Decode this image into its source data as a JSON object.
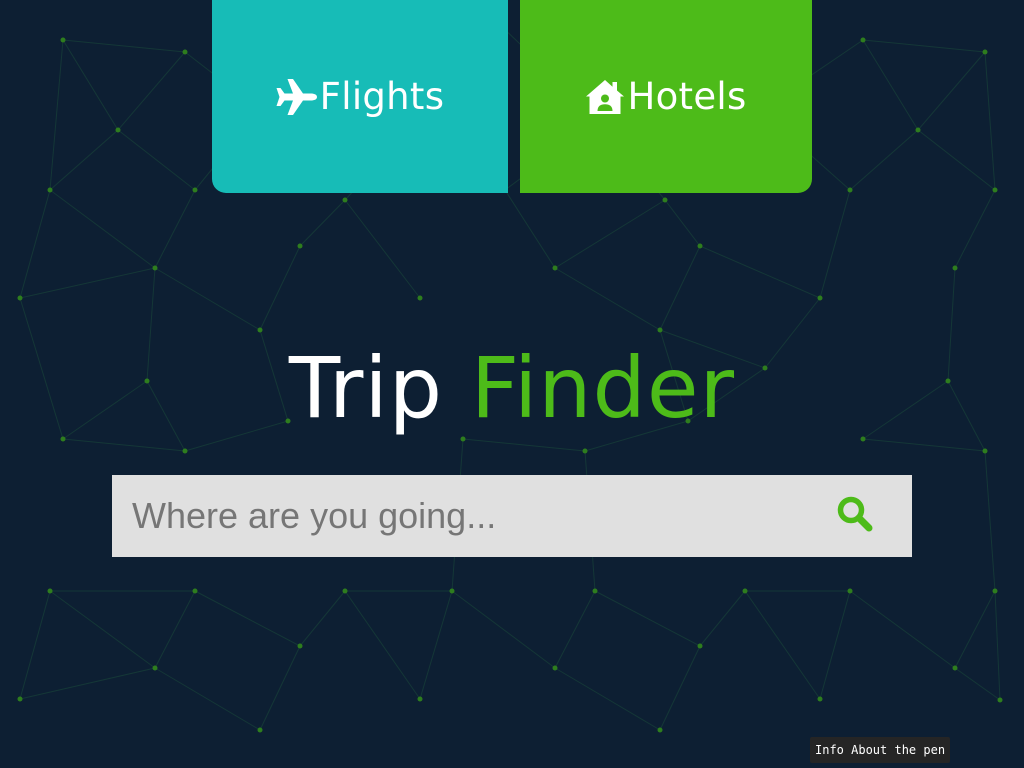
{
  "tiles": {
    "flights": {
      "label": "Flights",
      "icon": "plane-icon",
      "color": "#17bcb7"
    },
    "hotels": {
      "label": "Hotels",
      "icon": "house-user-icon",
      "color": "#4dbb19"
    }
  },
  "title": {
    "part1": "Trip",
    "part2": "Finder",
    "accent": "#4dbb19"
  },
  "search": {
    "placeholder": "Where are you going...",
    "value": "",
    "button_icon": "search-icon"
  },
  "footer": {
    "info_label": "Info About the pen"
  },
  "colors": {
    "background": "#0d1f33",
    "accent": "#4dbb19",
    "teal": "#17bcb7"
  }
}
